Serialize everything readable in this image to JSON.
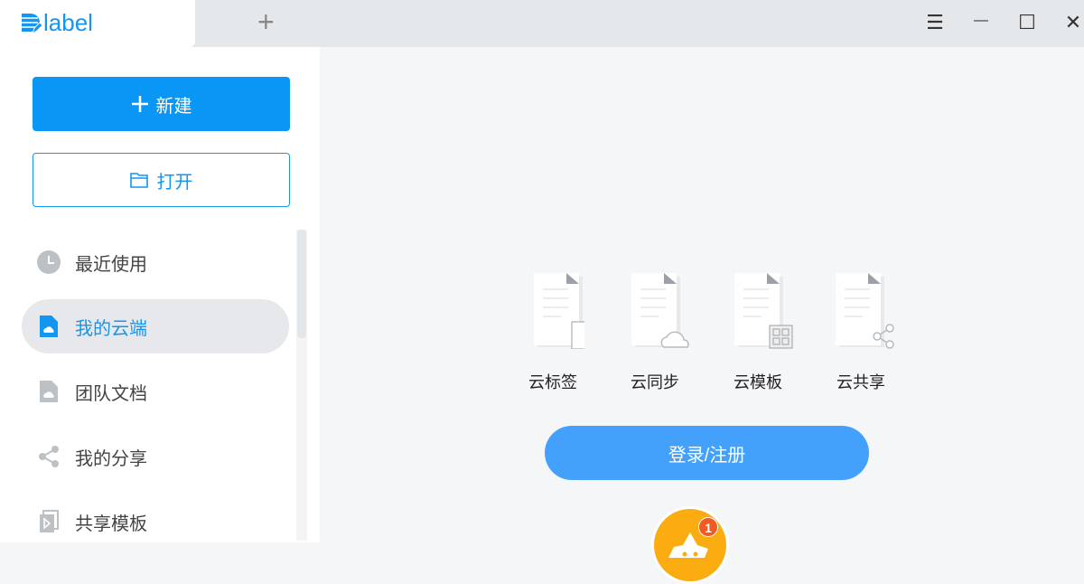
{
  "app": {
    "logo_text": "label"
  },
  "titlebar": {
    "new_tab": "+",
    "menu": "☰",
    "minimize": "—",
    "maximize": "☐",
    "close": "✕"
  },
  "sidebar": {
    "new_label": "新建",
    "open_label": "打开",
    "items": [
      {
        "label": "最近使用"
      },
      {
        "label": "我的云端"
      },
      {
        "label": "团队文档"
      },
      {
        "label": "我的分享"
      },
      {
        "label": "共享模板"
      }
    ]
  },
  "main": {
    "features": [
      {
        "label": "云标签"
      },
      {
        "label": "云同步"
      },
      {
        "label": "云模板"
      },
      {
        "label": "云共享"
      }
    ],
    "login_label": "登录/注册",
    "badge_count": "1"
  }
}
